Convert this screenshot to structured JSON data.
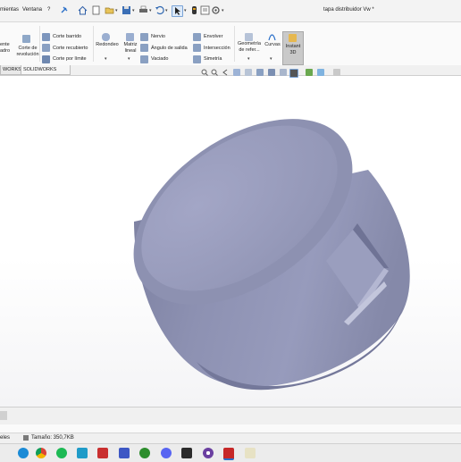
{
  "menubar": {
    "items": [
      "mientas",
      "Ventana",
      "?"
    ],
    "title": "tapa distribuidor Vw *"
  },
  "ribbon": {
    "partial_left": [
      "ente",
      "adro"
    ],
    "revolve_cut": [
      "Corte de",
      "revolución"
    ],
    "cut_group": [
      "Corte barrido",
      "Corte recubierto",
      "Corte por límite"
    ],
    "fillet": "Redondeo",
    "pattern": [
      "Matriz",
      "lineal"
    ],
    "feat_group": [
      "Nervio",
      "Ángulo de salida",
      "Vaciado"
    ],
    "feat_group2": [
      "Envolver",
      "Intersección",
      "Simetría"
    ],
    "refgeom": [
      "Geometría",
      "de refer..."
    ],
    "curves": "Curvas",
    "instant3d": [
      "Instant",
      "3D"
    ]
  },
  "tabs": [
    "WORKS",
    "SOLIDWORKS MBD"
  ],
  "status": {
    "left": "eles",
    "size": "Tamaño: 350,7KB"
  },
  "taskbar": {
    "icons": [
      "edge-icon",
      "chrome-icon",
      "spotify-icon",
      "c-app-icon",
      "teams-icon",
      "discord-icon",
      "onedrive-icon",
      "whatsapp-icon",
      "solidworks-icon",
      "xbox-icon",
      "epic-icon",
      "media-icon",
      "solidworks-alt-icon",
      "feather-icon"
    ]
  }
}
